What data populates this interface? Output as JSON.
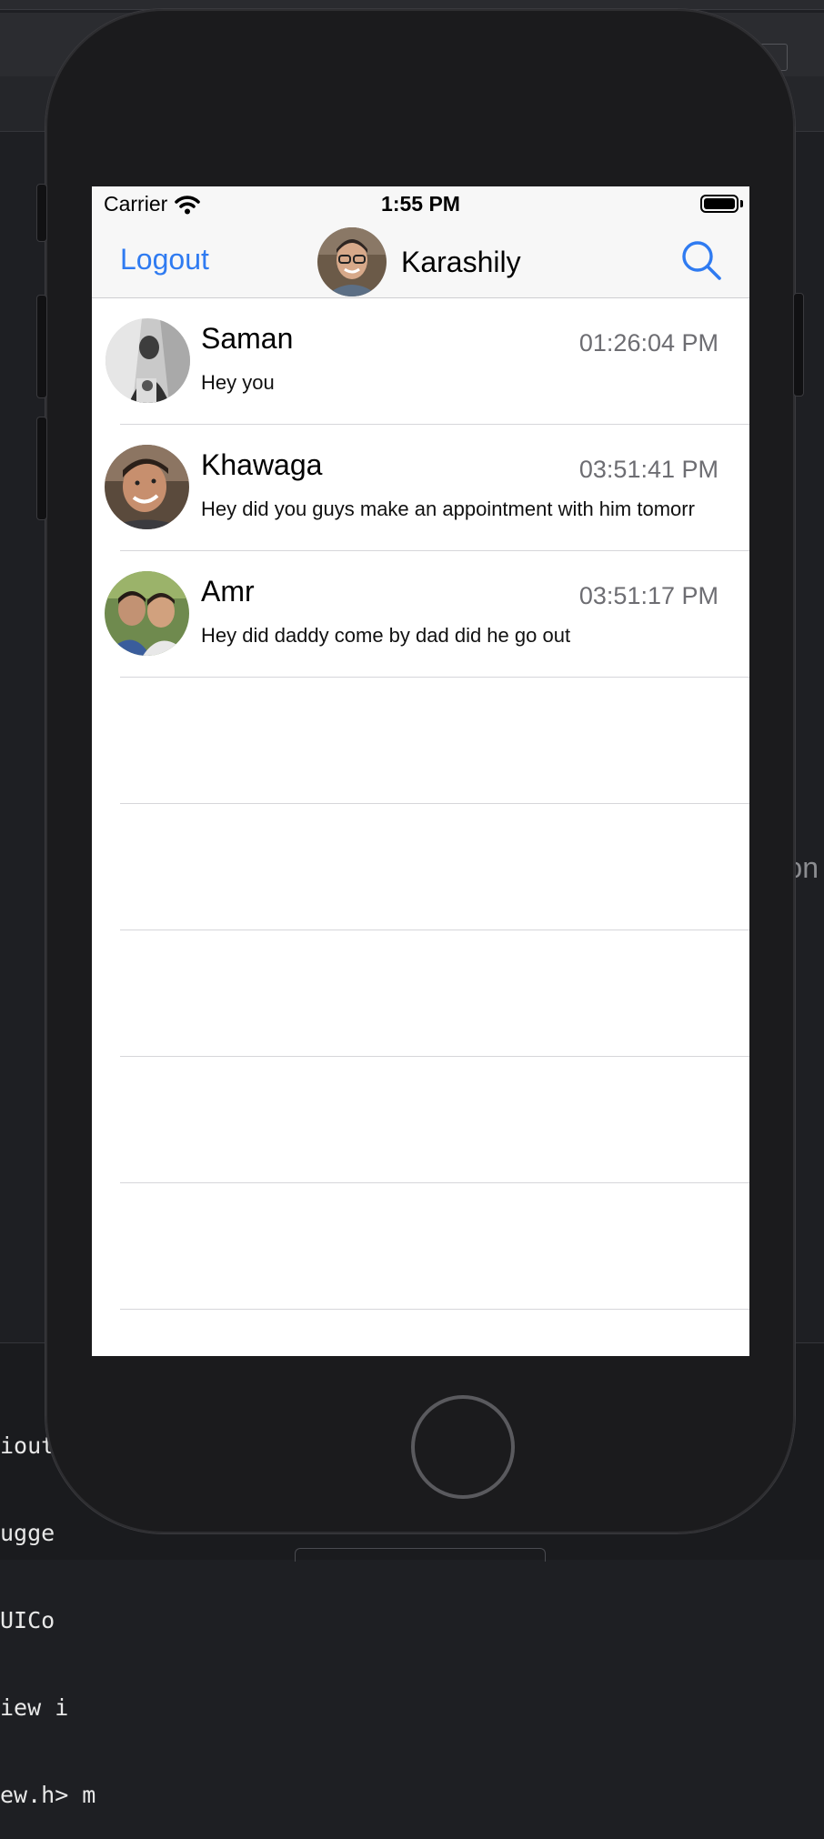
{
  "status_bar": {
    "carrier": "Carrier",
    "time": "1:55 PM"
  },
  "nav": {
    "left_button": "Logout",
    "title": "Karashily",
    "right_icon": "search-icon",
    "accent_color": "#2f7bf1"
  },
  "conversations": [
    {
      "name": "Saman",
      "time": "01:26:04 PM",
      "message": "Hey you"
    },
    {
      "name": "Khawaga",
      "time": "03:51:41 PM",
      "message": "Hey did you guys make an appointment with him tomorr"
    },
    {
      "name": "Amr",
      "time": "03:51:17 PM",
      "message": "Hey did daddy come by dad did he go out"
    }
  ],
  "background": {
    "side_text": "on",
    "console_lines": [
      "iout",
      "ugge",
      "UICo",
      "iew i",
      "ew.h> m"
    ]
  }
}
